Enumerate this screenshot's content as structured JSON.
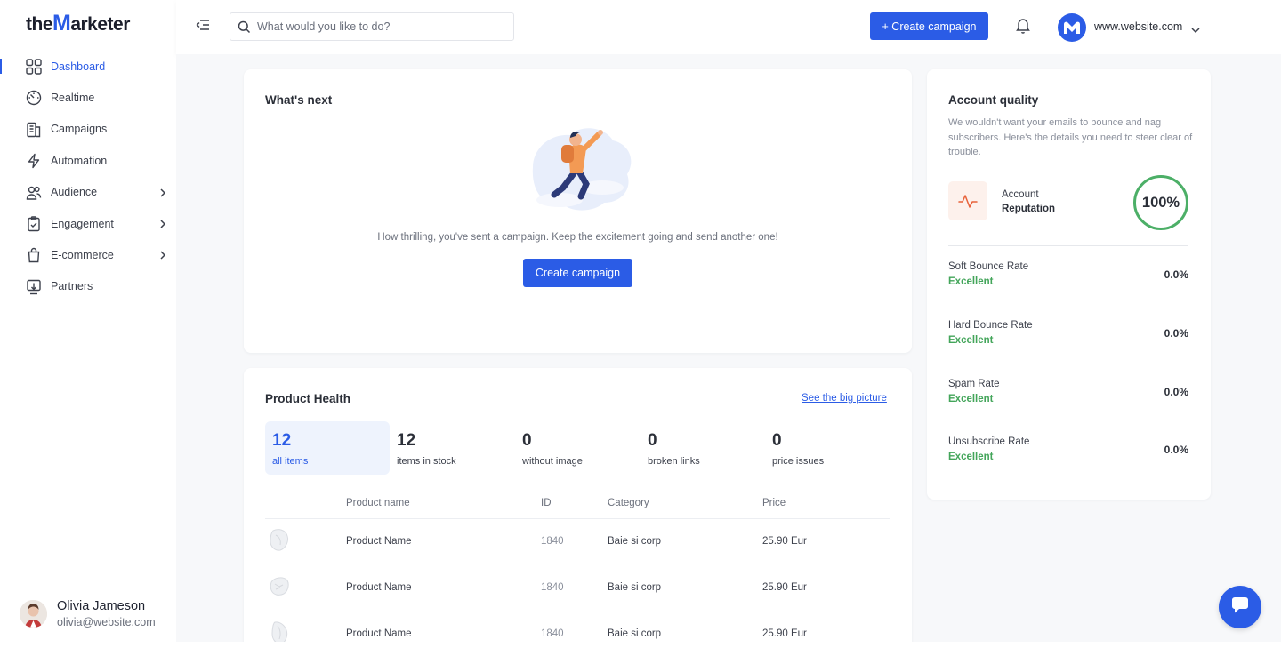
{
  "brand": {
    "logo_pre": "the",
    "logo_m": "M",
    "logo_post": "arketer",
    "accent": "#2b5ce6"
  },
  "sidebar": {
    "items": [
      {
        "label": "Dashboard",
        "icon": "grid-icon",
        "active": true
      },
      {
        "label": "Realtime",
        "icon": "gauge-icon"
      },
      {
        "label": "Campaigns",
        "icon": "document-icon"
      },
      {
        "label": "Automation",
        "icon": "lightning-icon"
      },
      {
        "label": "Audience",
        "icon": "users-icon",
        "expandable": true
      },
      {
        "label": "Engagement",
        "icon": "clipboard-check-icon",
        "expandable": true
      },
      {
        "label": "E-commerce",
        "icon": "shopping-bag-icon",
        "expandable": true
      },
      {
        "label": "Partners",
        "icon": "partners-icon"
      }
    ]
  },
  "user": {
    "name": "Olivia Jameson",
    "email": "olivia@website.com"
  },
  "topbar": {
    "search_placeholder": "What would you like to do?",
    "create_label": "+ Create campaign",
    "account": "www.website.com"
  },
  "whats_next": {
    "title": "What's next",
    "text": "How thrilling, you've sent a campaign. Keep the excitement going and send another one!",
    "button": "Create campaign"
  },
  "product_health": {
    "title": "Product Health",
    "link": "See the big picture",
    "stats": [
      {
        "value": "12",
        "label": "all items",
        "active": true
      },
      {
        "value": "12",
        "label": "items in stock"
      },
      {
        "value": "0",
        "label": "without image"
      },
      {
        "value": "0",
        "label": "broken links"
      },
      {
        "value": "0",
        "label": "price issues"
      }
    ],
    "columns": [
      "Product name",
      "ID",
      "Category",
      "Price"
    ],
    "rows": [
      {
        "name": "Product Name",
        "id": "1840",
        "category": "Baie si corp",
        "price": "25.90 Eur"
      },
      {
        "name": "Product Name",
        "id": "1840",
        "category": "Baie si corp",
        "price": "25.90 Eur"
      },
      {
        "name": "Product Name",
        "id": "1840",
        "category": "Baie si corp",
        "price": "25.90 Eur"
      }
    ]
  },
  "account_quality": {
    "title": "Account quality",
    "description": "We wouldn't want your emails to bounce and nag subscribers. Here's the details you need to steer clear of trouble.",
    "reputation_label1": "Account",
    "reputation_label2": "Reputation",
    "reputation_value": "100%",
    "metrics": [
      {
        "label": "Soft Bounce Rate",
        "status": "Excellent",
        "value": "0.0%"
      },
      {
        "label": "Hard Bounce Rate",
        "status": "Excellent",
        "value": "0.0%"
      },
      {
        "label": "Spam Rate",
        "status": "Excellent",
        "value": "0.0%"
      },
      {
        "label": "Unsubscribe Rate",
        "status": "Excellent",
        "value": "0.0%"
      }
    ]
  }
}
